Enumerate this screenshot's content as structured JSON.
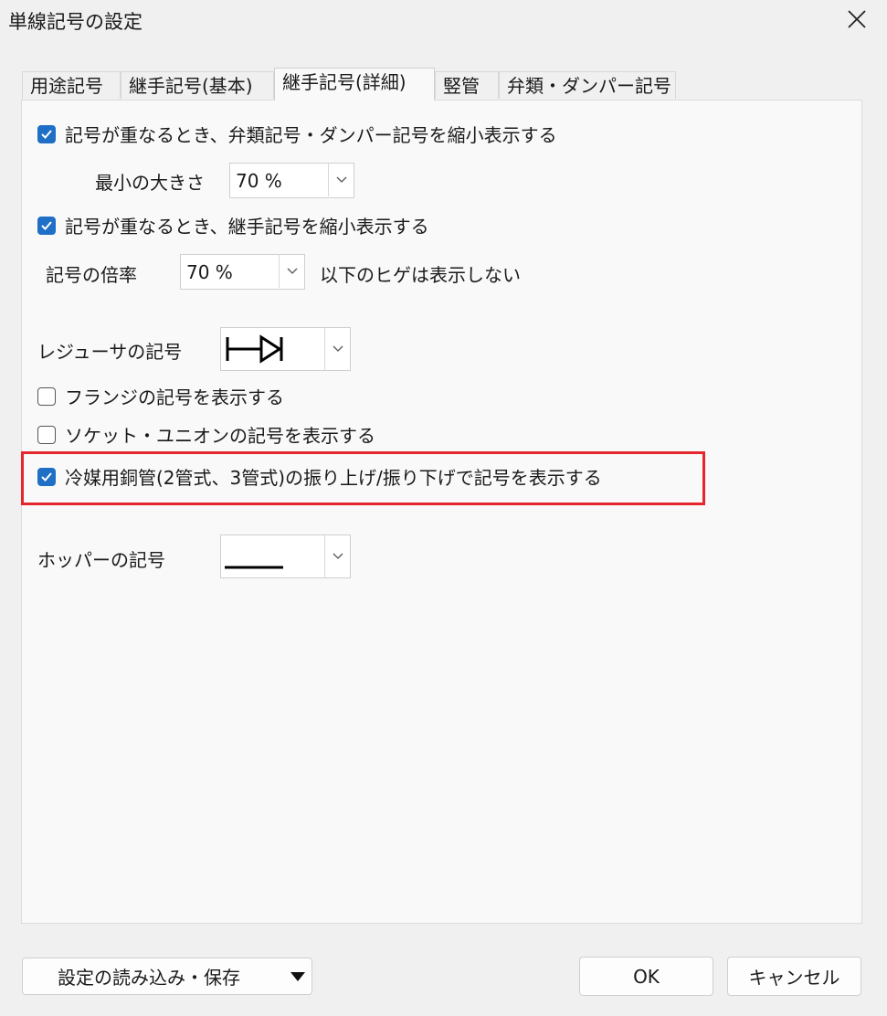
{
  "window": {
    "title": "単線記号の設定",
    "close_icon": "close-icon"
  },
  "tabs": [
    {
      "label": "用途記号"
    },
    {
      "label": "継手記号(基本)"
    },
    {
      "label": "継手記号(詳細)",
      "active": true
    },
    {
      "label": "竪管"
    },
    {
      "label": "弁類・ダンパー記号"
    }
  ],
  "options": {
    "shrink_valve": {
      "label": "記号が重なるとき、弁類記号・ダンパー記号を縮小表示する",
      "checked": true
    },
    "min_size": {
      "label": "最小の大きさ",
      "value": "70 %"
    },
    "shrink_fitting": {
      "label": "記号が重なるとき、継手記号を縮小表示する",
      "checked": true
    },
    "scale": {
      "label": "記号の倍率",
      "value": "70 %",
      "suffix": "以下のヒゲは表示しない"
    },
    "reducer": {
      "label": "レジューサの記号",
      "symbol": "reducer-symbol-icon"
    },
    "flange": {
      "label": "フランジの記号を表示する",
      "checked": false
    },
    "socket_union": {
      "label": "ソケット・ユニオンの記号を表示する",
      "checked": false
    },
    "refrigerant": {
      "label": "冷媒用銅管(2管式、3管式)の振り上げ/振り下げで記号を表示する",
      "checked": true
    },
    "hopper": {
      "label": "ホッパーの記号",
      "symbol": "hopper-line-symbol-icon"
    }
  },
  "footer": {
    "load_save": "設定の読み込み・保存",
    "ok": "OK",
    "cancel": "キャンセル"
  },
  "colors": {
    "accent": "#1f6fc6",
    "highlight": "#e5262d"
  }
}
